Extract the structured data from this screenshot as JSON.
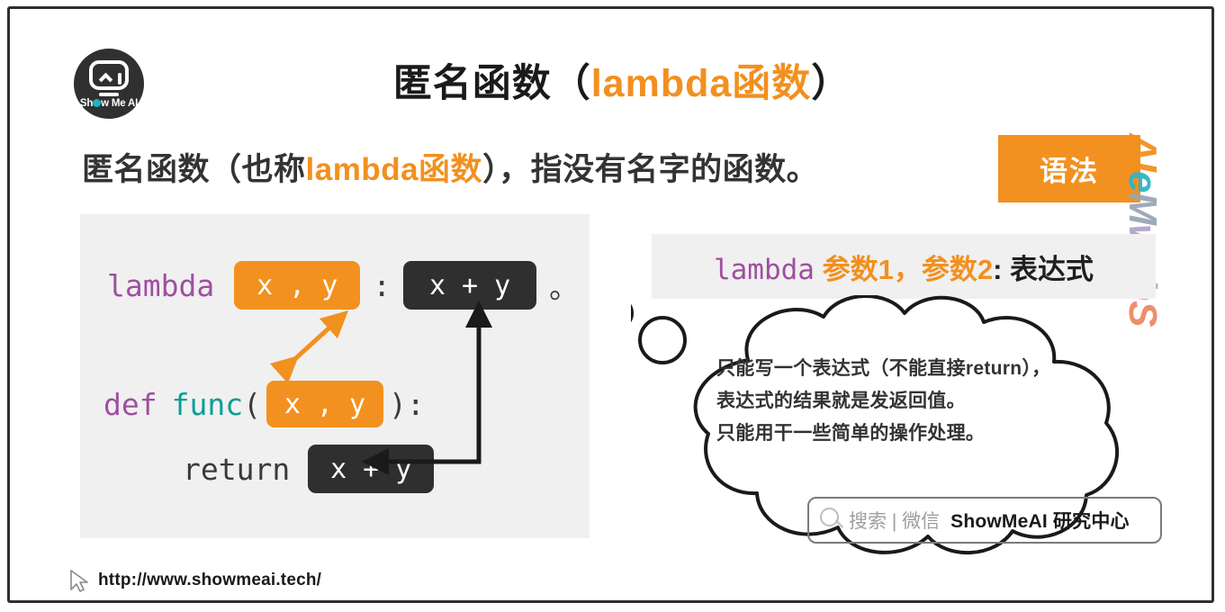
{
  "logo": {
    "brand_pre": "Sh",
    "brand_post": "w Me AI",
    "eye_left_icon": "caret-up-icon",
    "eye_right_icon": "bar-icon"
  },
  "title": {
    "part1": "匿名函数（",
    "part2": "lambda函数",
    "part3": "）"
  },
  "subtitle": {
    "part1": "匿名函数（也称",
    "part2": "lambda函数",
    "part3": "），指没有名字的函数。"
  },
  "badge": {
    "label": "语法"
  },
  "watermark": {
    "l1": "S",
    "l2": "h",
    "l3": "o",
    "l4": "w",
    "l5": "M",
    "l6": "e",
    "l7": "AI"
  },
  "syntax": {
    "keyword": "lambda",
    "params": " 参数1，参数2",
    "rest": ": 表达式"
  },
  "code": {
    "line1": {
      "keyword": "lambda",
      "params_pill": "x , y",
      "colon": ":",
      "expr_pill": "x + y",
      "period": "。"
    },
    "line2": {
      "keyword": "def",
      "name": "func",
      "lparen": "(",
      "params_pill": "x , y",
      "rparen": "):"
    },
    "line3": {
      "keyword": "return",
      "expr_pill": "x + y"
    }
  },
  "bubble": {
    "line1": "只能写一个表达式（不能直接return），",
    "line2": "表达式的结果就是发返回值。",
    "line3": "只能用干一些简单的操作处理。"
  },
  "search_watermark": {
    "gray_text": "搜索 | 微信",
    "brand_text": "ShowMeAI 研究中心"
  },
  "footer": {
    "url": "http://www.showmeai.tech/"
  },
  "colors": {
    "orange": "#f2911f",
    "dark": "#2f2f2f",
    "purple": "#a04fa0",
    "teal": "#0a9e96",
    "panel_bg": "#f0f0f0"
  }
}
